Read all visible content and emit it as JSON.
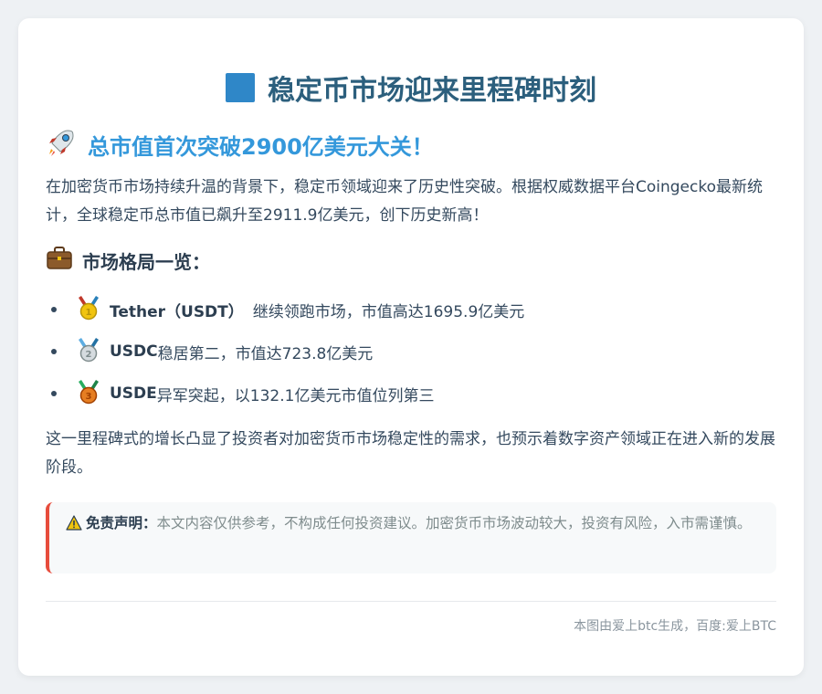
{
  "title": "稳定币市场迎来里程碑时刻",
  "headline": "总市值首次突破2900亿美元大关！",
  "intro": "在加密货币市场持续升温的背景下，稳定币领域迎来了历史性突破。根据权威数据平台Coingecko最新统计，全球稳定币总市值已飙升至2911.9亿美元，创下历史新高！",
  "section_title": "市场格局一览：",
  "market_items": [
    {
      "medal": "gold-medal-icon",
      "name": "Tether（USDT）",
      "text": "继续领跑市场，市值高达1695.9亿美元"
    },
    {
      "medal": "silver-medal-icon",
      "name": "USDC",
      "text": "稳居第二，市值达723.8亿美元"
    },
    {
      "medal": "bronze-medal-icon",
      "name": "USDE",
      "text": "异军突起，以132.1亿美元市值位列第三"
    }
  ],
  "closing": "这一里程碑式的增长凸显了投资者对加密货币市场稳定性的需求，也预示着数字资产领域正在进入新的发展阶段。",
  "disclaimer": {
    "label": "免责声明：",
    "text": "本文内容仅供参考，不构成任何投资建议。加密货币市场波动较大，投资有风险，入市需谨慎。"
  },
  "footer": "本图由爱上btc生成，百度:爱上BTC",
  "colors": {
    "accent": "#3498db",
    "title": "#2c5f7d",
    "warning_border": "#e74c3c"
  }
}
